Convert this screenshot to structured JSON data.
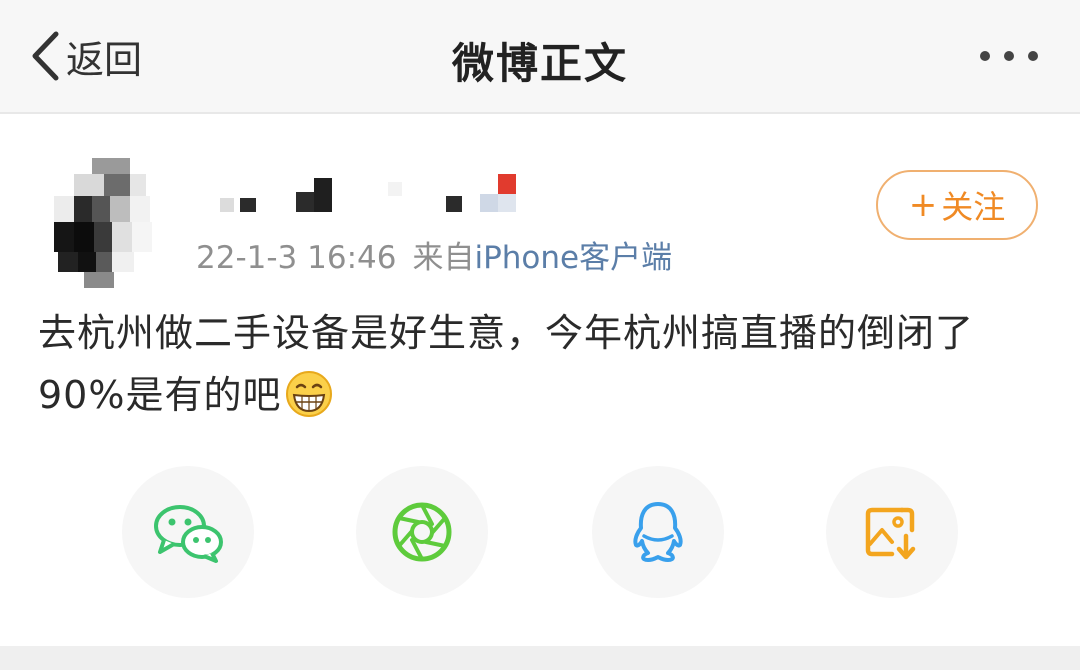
{
  "header": {
    "back_label": "返回",
    "title": "微博正文"
  },
  "post": {
    "time": "22-1-3 16:46",
    "source_prefix": "来自",
    "device": "iPhone客户端",
    "follow_label": "关注",
    "text": "去杭州做二手设备是好生意，今年杭州搞直播的倒闭了90%是有的吧"
  },
  "colors": {
    "accent_orange": "#f08a24",
    "wechat_green": "#3cc46e",
    "moments_green": "#5ecb3c",
    "qq_blue": "#39a0ec",
    "save_orange": "#f3a51e"
  },
  "icons": [
    "back-chevron-icon",
    "more-dots-icon",
    "grin-emoji-icon",
    "wechat-icon",
    "moments-icon",
    "qq-icon",
    "save-image-icon"
  ]
}
